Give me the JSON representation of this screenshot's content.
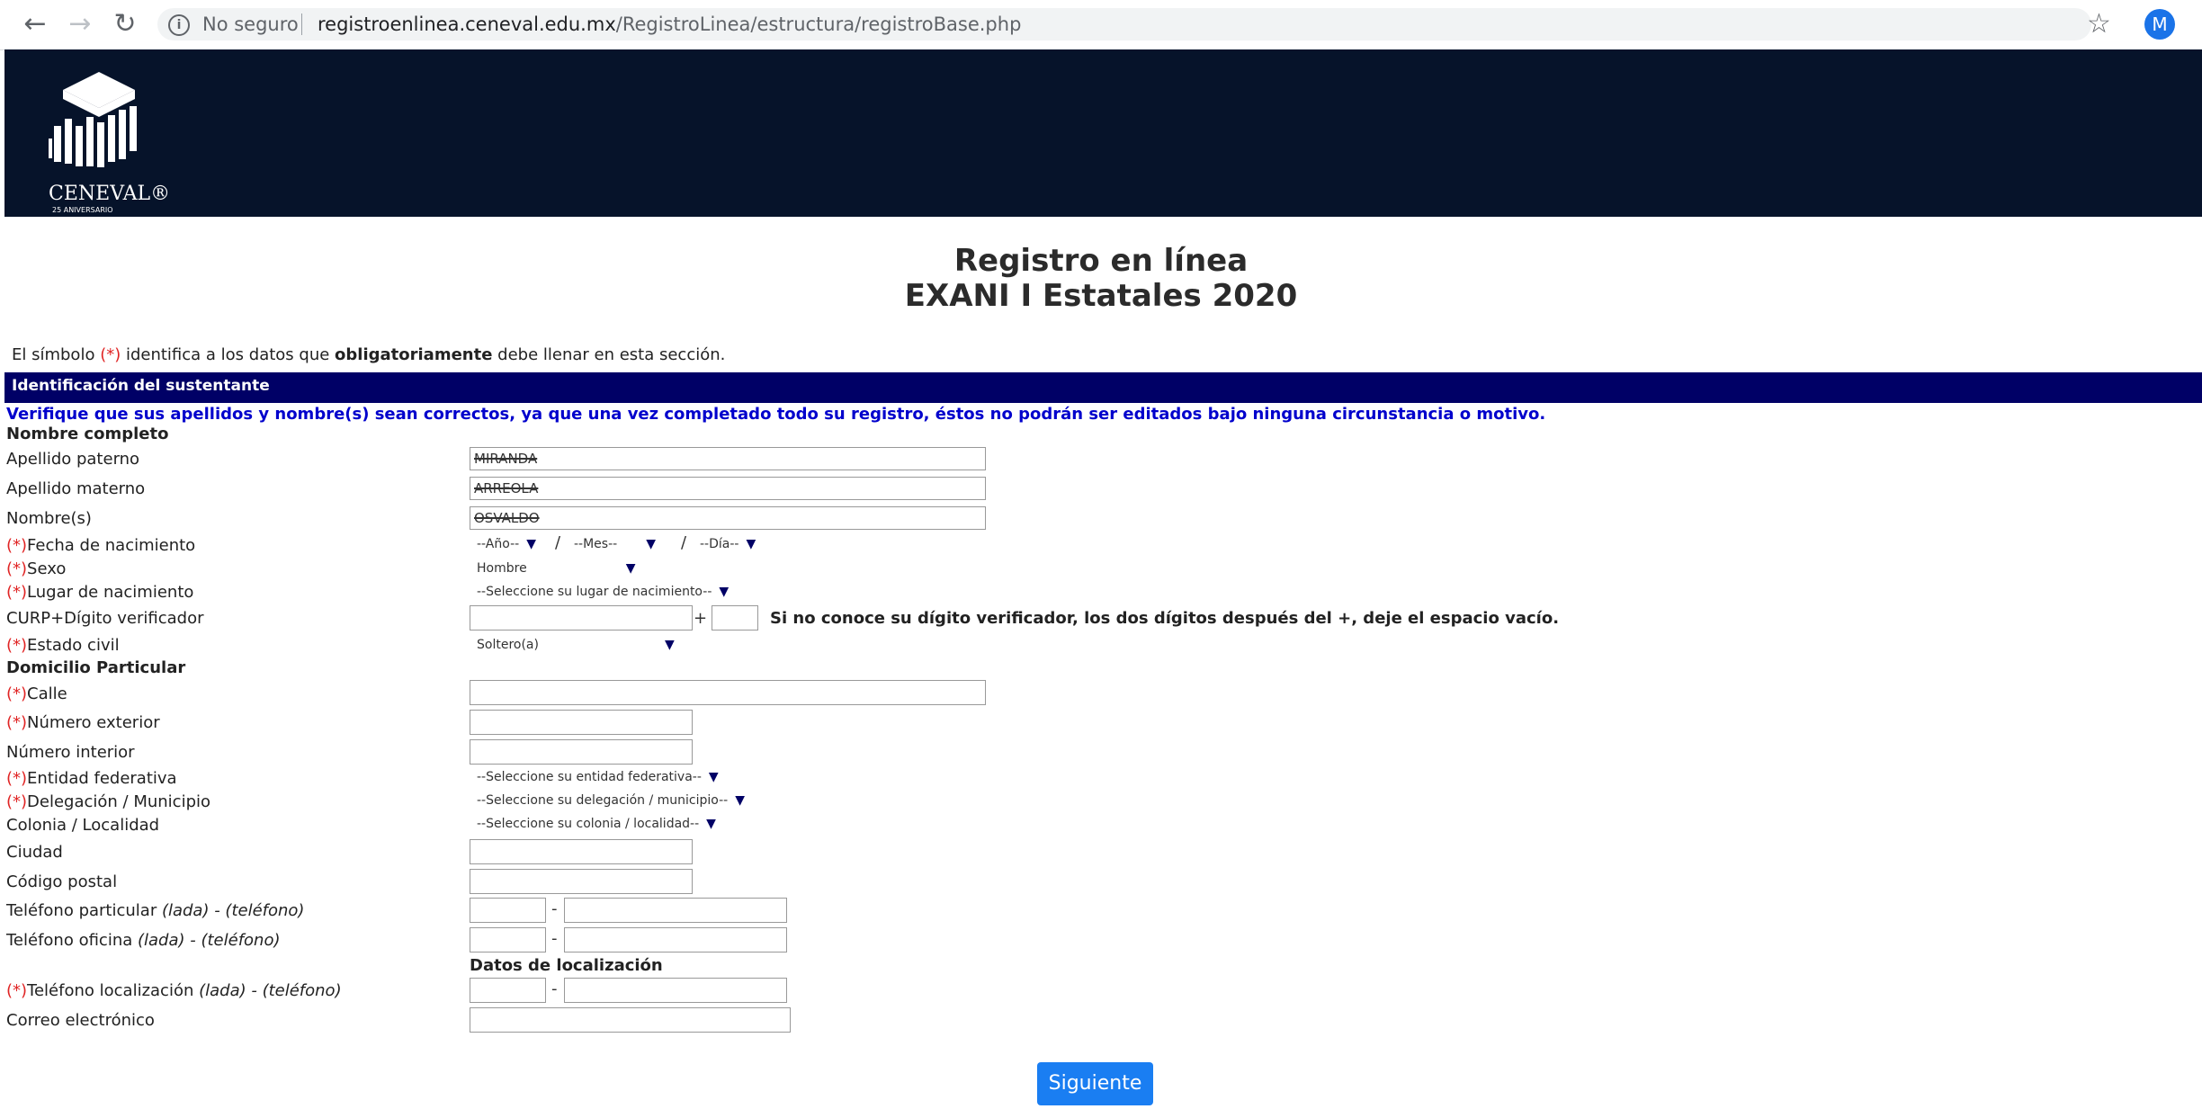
{
  "browser": {
    "not_secure_label": "No seguro",
    "url_domain": "registroenlinea.ceneval.edu.mx",
    "url_path": "/RegistroLinea/estructura/registroBase.php",
    "avatar_letter": "M"
  },
  "header": {
    "logo_text": "CENEVAL®",
    "logo_sub": "25 ANIVERSARIO",
    "bg_color": "#06132a"
  },
  "page": {
    "title_line1": "Registro en línea",
    "title_line2": "EXANI I Estatales 2020",
    "note_prefix": "El símbolo ",
    "note_symbol": "(*)",
    "note_middle": " identifica a los datos que ",
    "note_bold": "obligatoriamente",
    "note_suffix": " debe llenar en esta sección.",
    "section_title": "Identificación del sustentante",
    "warning": "Verifique que sus apellidos y nombre(s) sean correctos, ya que una vez completado todo su registro, éstos no podrán ser editados bajo ninguna circunstancia o motivo."
  },
  "req_mark": "(*)",
  "form": {
    "nombre_completo": "Nombre completo",
    "apellido_paterno": {
      "label": "Apellido paterno",
      "value": "MIRANDA"
    },
    "apellido_materno": {
      "label": "Apellido materno",
      "value": "ARREOLA"
    },
    "nombres": {
      "label": "Nombre(s)",
      "value": "OSVALDO"
    },
    "fecha": {
      "label": "Fecha de nacimiento",
      "anio": "--Año--",
      "mes": "--Mes--",
      "dia": "--Día--"
    },
    "sexo": {
      "label": "Sexo",
      "value": "Hombre"
    },
    "lugar": {
      "label": "Lugar de nacimiento",
      "value": "--Seleccione su lugar de nacimiento--"
    },
    "curp": {
      "label": "CURP+Dígito verificador",
      "plus": "+",
      "hint": "Si no conoce su dígito verificador, los dos dígitos después del +, deje el espacio vacío."
    },
    "estado_civil": {
      "label": "Estado civil",
      "value": "Soltero(a)"
    },
    "domicilio": "Domicilio Particular",
    "calle": "Calle",
    "num_ext": "Número exterior",
    "num_int": "Número interior",
    "entidad": {
      "label": "Entidad federativa",
      "value": "--Seleccione su entidad federativa--"
    },
    "delegacion": {
      "label": "Delegación / Municipio",
      "value": "--Seleccione su delegación / municipio--"
    },
    "colonia": {
      "label": "Colonia / Localidad",
      "value": "--Seleccione su colonia / localidad--"
    },
    "ciudad": "Ciudad",
    "cp": "Código postal",
    "tel_particular": {
      "label": "Teléfono particular ",
      "hint": "(lada) - (teléfono)"
    },
    "tel_oficina": {
      "label": "Teléfono oficina ",
      "hint": "(lada) - (teléfono)"
    },
    "datos_localizacion": "Datos de localización",
    "tel_localizacion": {
      "label": "Teléfono localización ",
      "hint": "(lada) - (teléfono)"
    },
    "correo": "Correo electrónico",
    "dash": "-",
    "slash": "/",
    "arrow": "▼"
  },
  "buttons": {
    "next": "Siguiente"
  },
  "icons": {
    "back": "arrow-left-icon",
    "forward": "arrow-right-icon",
    "reload": "reload-icon",
    "info": "info-icon",
    "star": "star-icon"
  }
}
